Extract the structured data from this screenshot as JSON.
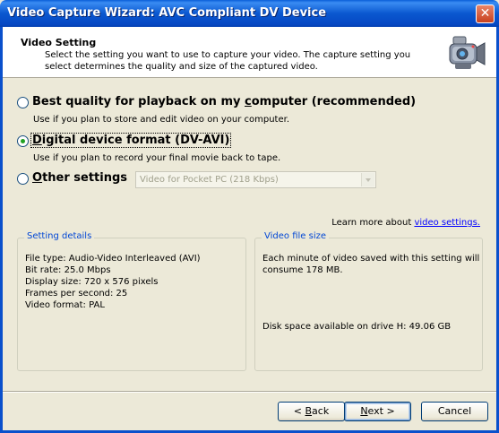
{
  "window": {
    "title": "Video Capture Wizard: AVC Compliant DV Device",
    "close_glyph": "✕"
  },
  "header": {
    "title": "Video Setting",
    "description": "Select the setting you want to use to capture your video. The capture setting you select determines the quality and size of the captured video.",
    "icon": "video-camera-icon"
  },
  "options": [
    {
      "label_pre": "Best quality for playback on my ",
      "label_key": "c",
      "label_post": "omputer (recommended)",
      "description": "Use if you plan to store and edit video on your computer.",
      "selected": false
    },
    {
      "label_pre": "",
      "label_key": "D",
      "label_post": "igital device format (DV-AVI)",
      "description": "Use if you plan to record your final movie back to tape.",
      "selected": true
    },
    {
      "label_pre": "",
      "label_key": "O",
      "label_post": "ther settings",
      "description": "",
      "selected": false
    }
  ],
  "other_settings_select": {
    "value": "Video for Pocket PC (218 Kbps)",
    "disabled": true
  },
  "learn_more": {
    "prefix": "Learn more about ",
    "link": "video settings."
  },
  "setting_details": {
    "title": "Setting details",
    "lines": [
      "File type: Audio-Video Interleaved (AVI)",
      "Bit rate: 25.0 Mbps",
      "Display size: 720 x 576 pixels",
      "Frames per second: 25",
      "Video format: PAL"
    ]
  },
  "video_file_size": {
    "title": "Video file size",
    "text": "Each minute of video saved with this setting  will consume 178 MB.",
    "disk_space": "Disk space available on drive H: 49.06 GB"
  },
  "buttons": {
    "back_prefix": "< ",
    "back_key": "B",
    "back_rest": "ack",
    "next_key": "N",
    "next_rest": "ext >",
    "cancel": "Cancel"
  },
  "colors": {
    "titlebar": "#0a58d0",
    "group_title": "#0046d5",
    "link": "#0000ff",
    "radio_dot": "#21a121"
  }
}
